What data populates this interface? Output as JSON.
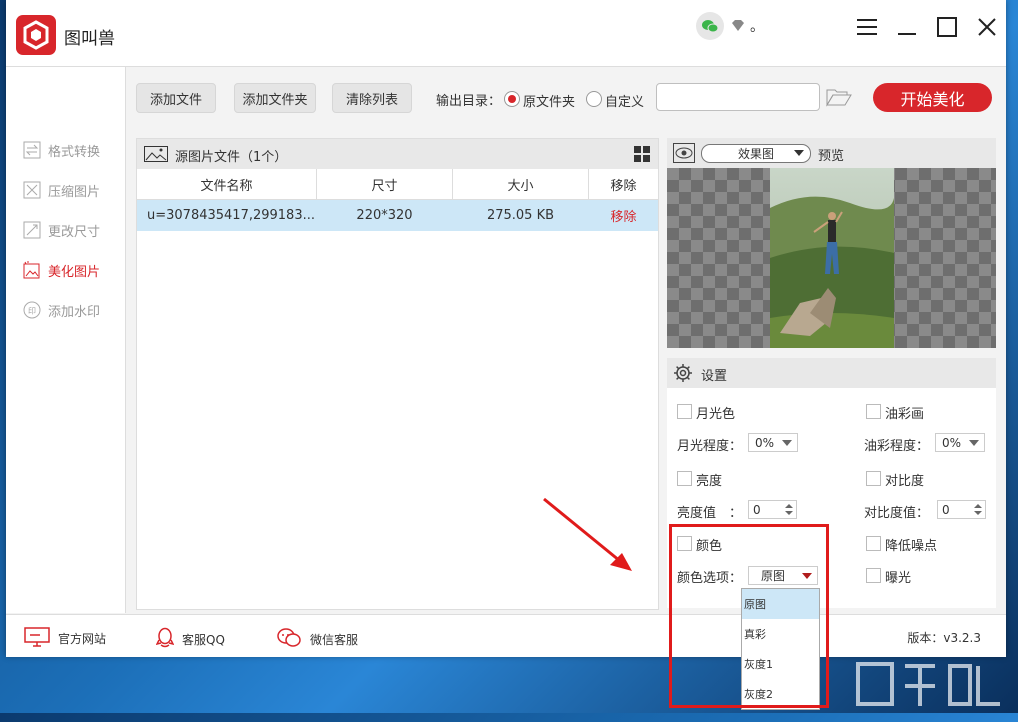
{
  "app": {
    "title": "图叫兽",
    "user_dot": "。"
  },
  "sidebar": {
    "items": [
      {
        "label": "格式转换"
      },
      {
        "label": "压缩图片"
      },
      {
        "label": "更改尺寸"
      },
      {
        "label": "美化图片"
      },
      {
        "label": "添加水印"
      }
    ]
  },
  "toolbar": {
    "add_file": "添加文件",
    "add_folder": "添加文件夹",
    "clear_list": "清除列表",
    "output_label": "输出目录：",
    "opt_source": "原文件夹",
    "opt_custom": "自定义",
    "path_value": "",
    "start": "开始美化"
  },
  "files": {
    "header": "源图片文件（1个）",
    "columns": [
      "文件名称",
      "尺寸",
      "大小",
      "移除"
    ],
    "rows": [
      {
        "name": "u=3078435417,299183...",
        "size": "220*320",
        "filesize": "275.05 KB",
        "remove": "移除"
      }
    ]
  },
  "preview": {
    "mode": "效果图",
    "label": "预览"
  },
  "settings": {
    "title": "设置",
    "moonlight": "月光色",
    "oil": "油彩画",
    "moon_level_label": "月光程度：",
    "moon_level": "0%",
    "oil_level_label": "油彩程度：",
    "oil_level": "0%",
    "brightness": "亮度",
    "contrast": "对比度",
    "brightness_val_label": "亮度值　：",
    "brightness_val": "0",
    "contrast_val_label": "对比度值：",
    "contrast_val": "0",
    "color": "颜色",
    "denoise": "降低噪点",
    "color_opt_label": "颜色选项：",
    "color_opt": "原图",
    "exposure": "曝光",
    "color_options": [
      "原图",
      "真彩",
      "灰度1",
      "灰度2"
    ]
  },
  "footer": {
    "website": "官方网站",
    "qq": "客服QQ",
    "wechat": "微信客服",
    "version": "版本：v3.2.3"
  },
  "colors": {
    "accent": "#d8262b",
    "highlight": "#cde7f7"
  }
}
